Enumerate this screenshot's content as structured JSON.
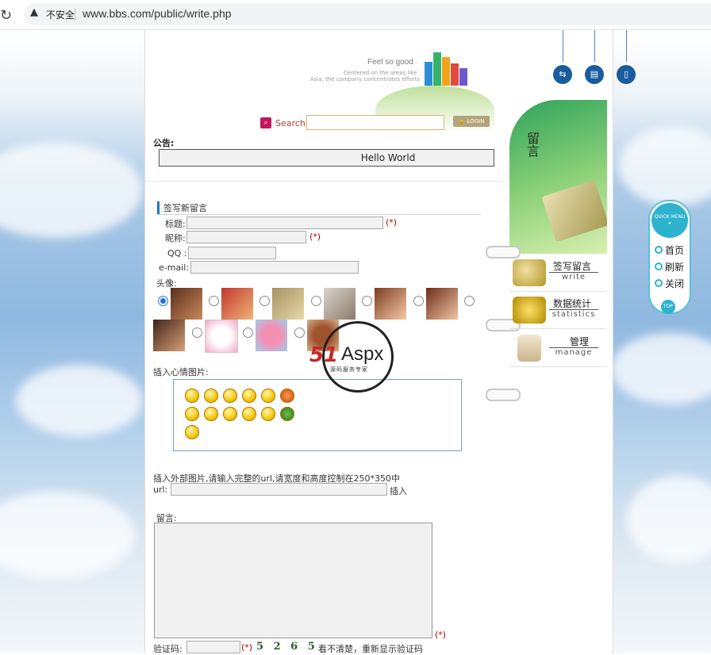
{
  "browser": {
    "security_label": "不安全",
    "url": "www.bbs.com/public/write.php"
  },
  "header": {
    "tagline": "Feel so good",
    "tagline_sub1": "Centered on the areas like",
    "tagline_sub2": "Asia, the company concentrates efforts",
    "search_label": "Search",
    "login_label": "LOGIN"
  },
  "notice": {
    "label": "公告:",
    "text": "Hello World"
  },
  "form": {
    "section_title": "签写新留言",
    "title_label": "标题:",
    "nickname_label": "昵称:",
    "qq_label": "QQ :",
    "email_label": "e-mail:",
    "required_mark": "(*)",
    "avatar_label": "头像:",
    "mood_label": "插入心情图片:",
    "external_note": "插入外部图片,请输入完整的url,请宽度和高度控制在250*350中",
    "url_label": "url:",
    "insert_label": "插入",
    "message_label": "留言:",
    "captcha_label": "验证码:",
    "captcha_code": "5 2 6 5",
    "captcha_refresh": "看不清楚，重新显示验证码"
  },
  "sidebar": {
    "badge": "留言",
    "items": [
      {
        "cn": "签写留言",
        "en": "write"
      },
      {
        "cn": "数据统计",
        "en": "statistics"
      },
      {
        "cn": "管理",
        "en": "manage"
      }
    ]
  },
  "quick_menu": {
    "title": "QUICK MENU",
    "items": [
      "首页",
      "刷新",
      "关闭"
    ],
    "top": "TOP"
  },
  "watermark": {
    "brand_num": "51",
    "brand_text": "Aspx",
    "sub": "源码服务专家"
  }
}
